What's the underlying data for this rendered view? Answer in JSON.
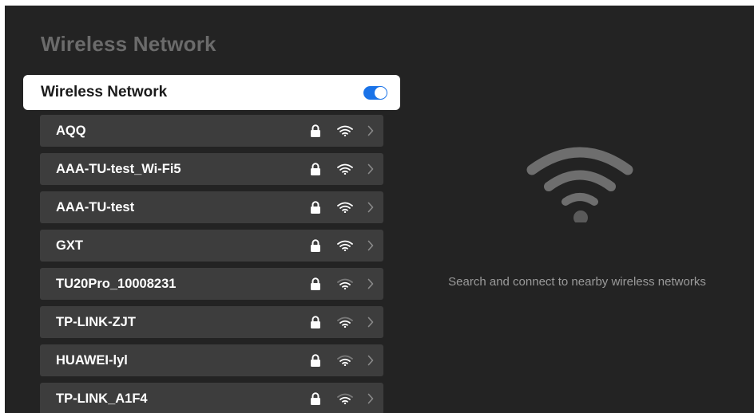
{
  "page": {
    "title": "Wireless Network"
  },
  "toggle": {
    "label": "Wireless Network",
    "state": "on",
    "accent_color": "#1a73e8"
  },
  "networks": [
    {
      "name": "AQQ",
      "secured": true,
      "signal": 3
    },
    {
      "name": "AAA-TU-test_Wi-Fi5",
      "secured": true,
      "signal": 3
    },
    {
      "name": "AAA-TU-test",
      "secured": true,
      "signal": 3
    },
    {
      "name": "GXT",
      "secured": true,
      "signal": 3
    },
    {
      "name": "TU20Pro_10008231",
      "secured": true,
      "signal": 2
    },
    {
      "name": "TP-LINK-ZJT",
      "secured": true,
      "signal": 2
    },
    {
      "name": "HUAWEI-lyl",
      "secured": true,
      "signal": 2
    },
    {
      "name": "TP-LINK_A1F4",
      "secured": true,
      "signal": 2
    }
  ],
  "icons": {
    "lock": "lock-icon",
    "wifi": "wifi-signal-icon",
    "chevron": "chevron-right-icon",
    "hero": "wifi-icon"
  },
  "right_panel": {
    "hint": "Search and connect to nearby wireless networks"
  }
}
